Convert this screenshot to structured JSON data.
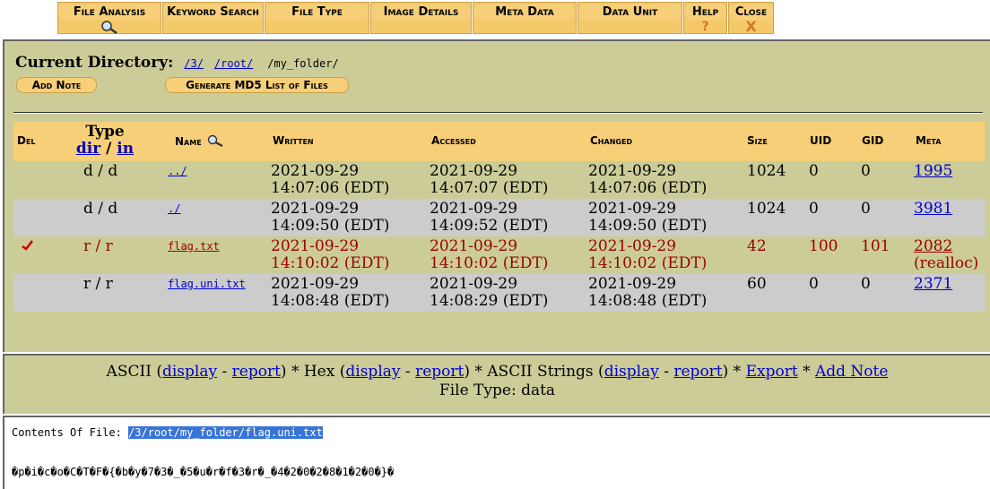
{
  "tabs": [
    {
      "label": "File Analysis",
      "icon": "magnifier-icon"
    },
    {
      "label": "Keyword Search"
    },
    {
      "label": "File Type"
    },
    {
      "label": "Image Details"
    },
    {
      "label": "Meta Data"
    },
    {
      "label": "Data Unit"
    },
    {
      "label": "Help",
      "sub": "?"
    },
    {
      "label": "Close",
      "sub": "X"
    }
  ],
  "current_dir": {
    "label": "Current Directory:",
    "parts": [
      "/3/",
      "/root/"
    ],
    "current": "/my_folder/"
  },
  "buttons": {
    "add_note": "Add Note",
    "md5": "Generate MD5 List of Files"
  },
  "table": {
    "headers": {
      "del": "Del",
      "type": "Type",
      "type_dir": "dir",
      "type_sep": "/",
      "type_in": "in",
      "name": "Name",
      "written": "Written",
      "accessed": "Accessed",
      "changed": "Changed",
      "size": "Size",
      "uid": "UID",
      "gid": "GID",
      "meta": "Meta"
    },
    "rows": [
      {
        "type": "d / d",
        "name": "../",
        "written": [
          "2021-09-29",
          "14:07:06 (EDT)"
        ],
        "accessed": [
          "2021-09-29",
          "14:07:07 (EDT)"
        ],
        "changed": [
          "2021-09-29",
          "14:07:06 (EDT)"
        ],
        "size": "1024",
        "uid": "0",
        "gid": "0",
        "meta": "1995",
        "meta_note": "",
        "deleted": false
      },
      {
        "type": "d / d",
        "name": "./",
        "written": [
          "2021-09-29",
          "14:09:50 (EDT)"
        ],
        "accessed": [
          "2021-09-29",
          "14:09:52 (EDT)"
        ],
        "changed": [
          "2021-09-29",
          "14:09:50 (EDT)"
        ],
        "size": "1024",
        "uid": "0",
        "gid": "0",
        "meta": "3981",
        "meta_note": "",
        "deleted": false
      },
      {
        "type": "r / r",
        "name": "flag.txt",
        "written": [
          "2021-09-29",
          "14:10:02 (EDT)"
        ],
        "accessed": [
          "2021-09-29",
          "14:10:02 (EDT)"
        ],
        "changed": [
          "2021-09-29",
          "14:10:02 (EDT)"
        ],
        "size": "42",
        "uid": "100",
        "gid": "101",
        "meta": "2082",
        "meta_note": "(realloc)",
        "deleted": true
      },
      {
        "type": "r / r",
        "name": "flag.uni.txt",
        "written": [
          "2021-09-29",
          "14:08:48 (EDT)"
        ],
        "accessed": [
          "2021-09-29",
          "14:08:29 (EDT)"
        ],
        "changed": [
          "2021-09-29",
          "14:08:48 (EDT)"
        ],
        "size": "60",
        "uid": "0",
        "gid": "0",
        "meta": "2371",
        "meta_note": "",
        "deleted": false
      }
    ]
  },
  "view": {
    "ascii": "ASCII",
    "hex": "Hex",
    "strings": "ASCII Strings",
    "display": "display",
    "report": "report",
    "export": "Export",
    "add_note": "Add Note",
    "file_type_label": "File Type:",
    "file_type": "data"
  },
  "contents": {
    "label": "Contents Of File:",
    "path": "/3/root/my_folder/flag.uni.txt",
    "data": "�p�i�c�o�C�T�F�{�b�y�7�3�_�5�u�r�f�3�r�_�4�2�0�2�8�1�2�0�}�"
  },
  "colors": {
    "tab": "#f6cf78",
    "panel": "#cccc99",
    "row_alt": "#cccccc",
    "deleted": "#990000",
    "link": "#0000cc"
  }
}
